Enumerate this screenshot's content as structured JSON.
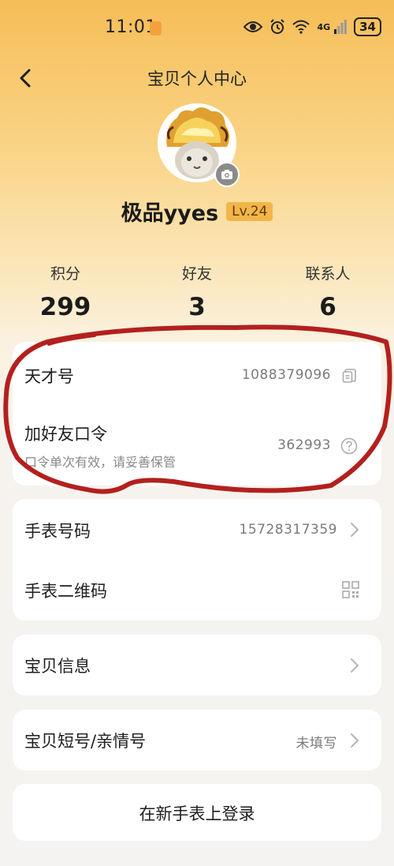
{
  "status_bar": {
    "time": "11:01",
    "network": "4G",
    "battery": "34"
  },
  "header": {
    "title": "宝贝个人中心"
  },
  "profile": {
    "username": "极品yyes",
    "level": "Lv.24"
  },
  "stats": [
    {
      "label": "积分",
      "value": "299"
    },
    {
      "label": "好友",
      "value": "3"
    },
    {
      "label": "联系人",
      "value": "6"
    }
  ],
  "account": {
    "genius_label": "天才号",
    "genius_value": "1088379096",
    "password_label": "加好友口令",
    "password_hint": "口令单次有效，请妥善保管",
    "password_value": "362993"
  },
  "watch": {
    "number_label": "手表号码",
    "number_value": "15728317359",
    "qr_label": "手表二维码"
  },
  "baby_info": {
    "label": "宝贝信息"
  },
  "short_number": {
    "label": "宝贝短号/亲情号",
    "value": "未填写"
  },
  "login_button": {
    "label": "在新手表上登录"
  },
  "colors": {
    "accent": "#f3b54a",
    "annotation": "#b3201e"
  }
}
